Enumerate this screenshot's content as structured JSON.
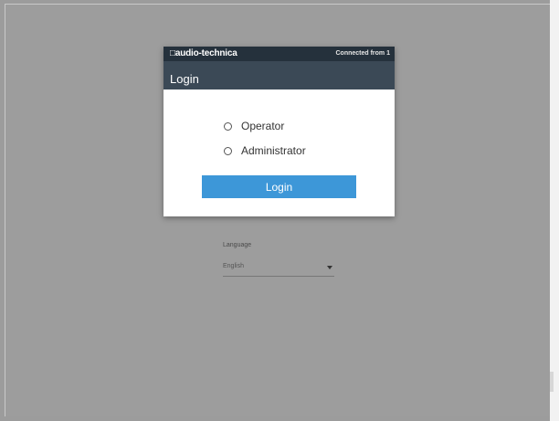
{
  "header": {
    "brand": "□audio-technica",
    "connection_status": "Connected from 1",
    "title": "Login"
  },
  "roles": [
    {
      "label": "Operator",
      "selected": false
    },
    {
      "label": "Administrator",
      "selected": false
    }
  ],
  "login_button_label": "Login",
  "language": {
    "label": "Language",
    "value": "English"
  },
  "colors": {
    "background": "#9d9d9d",
    "header_dark": "#25313c",
    "header": "#3b4956",
    "accent_button": "#3d97d8"
  }
}
